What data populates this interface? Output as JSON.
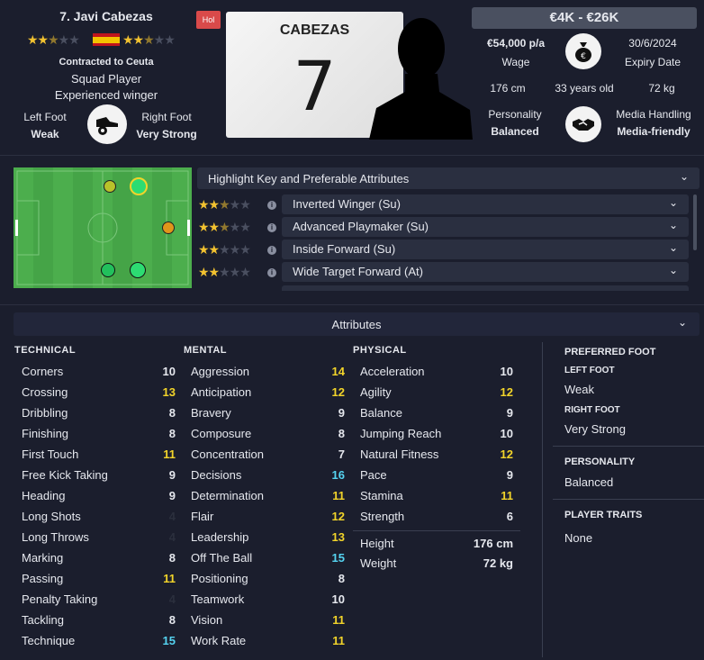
{
  "player": {
    "name": "7. Javi Cabezas",
    "contract": "Contracted to Ceuta",
    "squad_status": "Squad Player",
    "description": "Experienced winger",
    "ability_stars": 2.5,
    "potential_stars": 2.5,
    "left_foot_label": "Left Foot",
    "left_foot_value": "Weak",
    "right_foot_label": "Right Foot",
    "right_foot_value": "Very Strong",
    "shirt_name": "CABEZAS",
    "shirt_number": "7",
    "badge": "Hol"
  },
  "info": {
    "value_range": "€4K - €26K",
    "wage_amount": "€54,000 p/a",
    "wage_label": "Wage",
    "expiry_date": "30/6/2024",
    "expiry_label": "Expiry Date",
    "height": "176 cm",
    "age": "33 years old",
    "weight": "72 kg",
    "personality_label": "Personality",
    "personality_value": "Balanced",
    "media_label": "Media Handling",
    "media_value": "Media-friendly"
  },
  "roles": {
    "header": "Highlight Key and Preferable Attributes",
    "items": [
      {
        "label": "Inverted Winger (Su)",
        "stars": 2.5
      },
      {
        "label": "Advanced Playmaker (Su)",
        "stars": 2.5
      },
      {
        "label": "Inside Forward (Su)",
        "stars": 2
      },
      {
        "label": "Wide Target Forward (At)",
        "stars": 2
      }
    ]
  },
  "attributes": {
    "header": "Attributes",
    "technical_title": "TECHNICAL",
    "technical": [
      {
        "name": "Corners",
        "value": "10"
      },
      {
        "name": "Crossing",
        "value": "13"
      },
      {
        "name": "Dribbling",
        "value": "8"
      },
      {
        "name": "Finishing",
        "value": "8"
      },
      {
        "name": "First Touch",
        "value": "11"
      },
      {
        "name": "Free Kick Taking",
        "value": "9"
      },
      {
        "name": "Heading",
        "value": "9"
      },
      {
        "name": "Long Shots",
        "value": "4"
      },
      {
        "name": "Long Throws",
        "value": "4"
      },
      {
        "name": "Marking",
        "value": "8"
      },
      {
        "name": "Passing",
        "value": "11"
      },
      {
        "name": "Penalty Taking",
        "value": "4"
      },
      {
        "name": "Tackling",
        "value": "8"
      },
      {
        "name": "Technique",
        "value": "15"
      }
    ],
    "mental_title": "MENTAL",
    "mental": [
      {
        "name": "Aggression",
        "value": "14"
      },
      {
        "name": "Anticipation",
        "value": "12"
      },
      {
        "name": "Bravery",
        "value": "9"
      },
      {
        "name": "Composure",
        "value": "8"
      },
      {
        "name": "Concentration",
        "value": "7"
      },
      {
        "name": "Decisions",
        "value": "16"
      },
      {
        "name": "Determination",
        "value": "11"
      },
      {
        "name": "Flair",
        "value": "12"
      },
      {
        "name": "Leadership",
        "value": "13"
      },
      {
        "name": "Off The Ball",
        "value": "15"
      },
      {
        "name": "Positioning",
        "value": "8"
      },
      {
        "name": "Teamwork",
        "value": "10"
      },
      {
        "name": "Vision",
        "value": "11"
      },
      {
        "name": "Work Rate",
        "value": "11"
      }
    ],
    "physical_title": "PHYSICAL",
    "physical": [
      {
        "name": "Acceleration",
        "value": "10"
      },
      {
        "name": "Agility",
        "value": "12"
      },
      {
        "name": "Balance",
        "value": "9"
      },
      {
        "name": "Jumping Reach",
        "value": "10"
      },
      {
        "name": "Natural Fitness",
        "value": "12"
      },
      {
        "name": "Pace",
        "value": "9"
      },
      {
        "name": "Stamina",
        "value": "11"
      },
      {
        "name": "Strength",
        "value": "6"
      }
    ],
    "height_label": "Height",
    "height_value": "176 cm",
    "weight_label": "Weight",
    "weight_value": "72 kg"
  },
  "side": {
    "preferred_foot_title": "PREFERRED FOOT",
    "left_foot_title": "LEFT FOOT",
    "left_foot_value": "Weak",
    "right_foot_title": "RIGHT FOOT",
    "right_foot_value": "Very Strong",
    "personality_title": "PERSONALITY",
    "personality_value": "Balanced",
    "traits_title": "PLAYER TRAITS",
    "traits_value": "None"
  },
  "colors": {
    "background": "#1b1e2d",
    "panel": "#2a2f40",
    "star": "#f2c230",
    "pitch": "#4aa84a",
    "value_white": "#e6e8ee",
    "value_yellow": "#f2d42a",
    "value_blue": "#55d3f0"
  }
}
